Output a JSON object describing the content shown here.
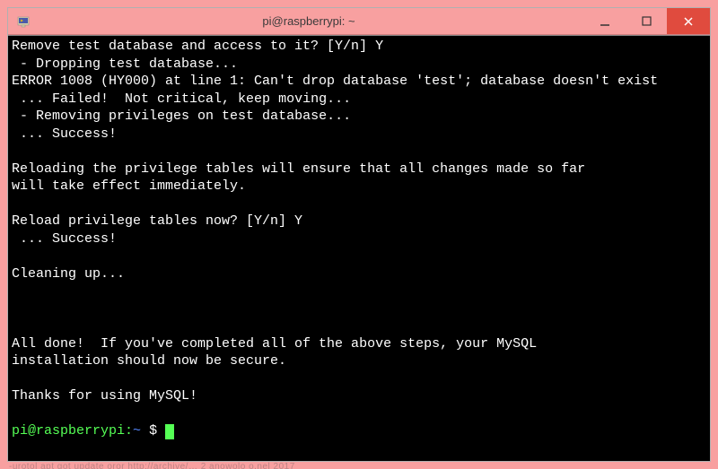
{
  "window": {
    "title": "pi@raspberrypi: ~"
  },
  "terminal": {
    "lines": [
      "Remove test database and access to it? [Y/n] Y",
      " - Dropping test database...",
      "ERROR 1008 (HY000) at line 1: Can't drop database 'test'; database doesn't exist",
      " ... Failed!  Not critical, keep moving...",
      " - Removing privileges on test database...",
      " ... Success!",
      "",
      "Reloading the privilege tables will ensure that all changes made so far",
      "will take effect immediately.",
      "",
      "Reload privilege tables now? [Y/n] Y",
      " ... Success!",
      "",
      "Cleaning up...",
      "",
      "",
      "",
      "All done!  If you've completed all of the above steps, your MySQL",
      "installation should now be secure.",
      "",
      "Thanks for using MySQL!",
      ""
    ],
    "prompt": {
      "user_host": "pi@raspberrypi",
      "colon": ":",
      "path": "~ ",
      "dollar": "$ "
    }
  },
  "footer_noise": "-urotol apt got update oror   http://archive/…                                     2 anowolo    o.nel 2017"
}
